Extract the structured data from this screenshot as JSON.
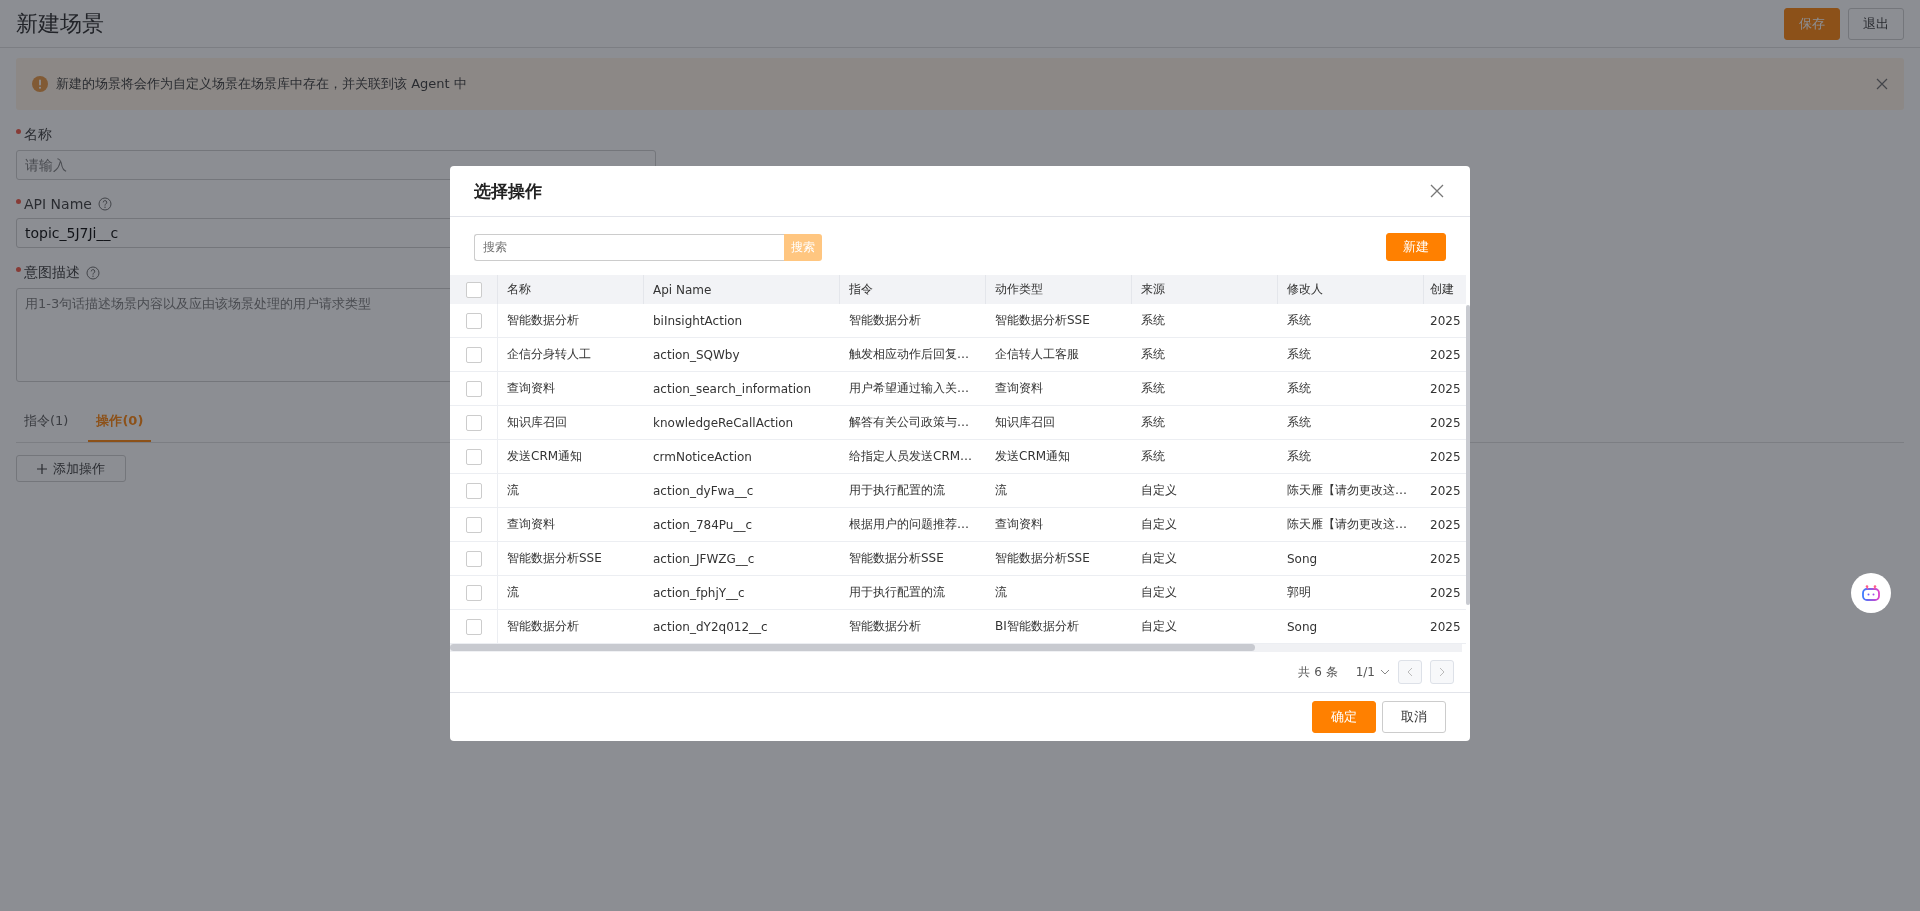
{
  "page": {
    "title": "新建场景",
    "buttons": [
      {
        "label": "保存",
        "kind": "primary"
      },
      {
        "label": "退出",
        "kind": "default"
      }
    ]
  },
  "alert": {
    "text": "新建的场景将会作为自定义场景在场景库中存在，并关联到该 Agent 中",
    "closable": true
  },
  "form": {
    "fields": [
      {
        "label": "名称",
        "required": true,
        "help": false,
        "kind": "input",
        "placeholder": "请输入"
      },
      {
        "label": "API Name",
        "required": true,
        "help": true,
        "kind": "input",
        "value": "topic_5J7Ji__c"
      },
      {
        "label": "意图描述",
        "required": true,
        "help": true,
        "kind": "textarea",
        "placeholder": "用1-3句话描述场景内容以及应由该场景处理的用户请求类型"
      }
    ]
  },
  "tabs": [
    {
      "label": "指令(1)",
      "selected": false
    },
    {
      "label": "操作(0)",
      "selected": true
    }
  ],
  "add_button": "添加操作",
  "dialog": {
    "title": "选择操作",
    "search": {
      "placeholder": "搜索",
      "button": "搜索"
    },
    "new_button": "新建",
    "table": {
      "all_checked": false,
      "columns": [
        "名称",
        "Api Name",
        "指令",
        "动作类型",
        "来源",
        "修改人",
        "创建"
      ],
      "rows": [
        {
          "checked": false,
          "cells": [
            "智能数据分析",
            "biInsightAction",
            "智能数据分析",
            "智能数据分析SSE",
            "系统",
            "系统",
            "2025"
          ]
        },
        {
          "checked": false,
          "cells": [
            "企信分身转人工",
            "action_SQWby",
            "触发相应动作后回复…",
            "企信转人工客服",
            "系统",
            "系统",
            "2025"
          ]
        },
        {
          "checked": false,
          "cells": [
            "查询资料",
            "action_search_information",
            "用户希望通过输入关…",
            "查询资料",
            "系统",
            "系统",
            "2025"
          ]
        },
        {
          "checked": false,
          "cells": [
            "知识库召回",
            "knowledgeReCallAction",
            "解答有关公司政策与…",
            "知识库召回",
            "系统",
            "系统",
            "2025"
          ]
        },
        {
          "checked": false,
          "cells": [
            "发送CRM通知",
            "crmNoticeAction",
            "给指定人员发送CRM…",
            "发送CRM通知",
            "系统",
            "系统",
            "2025"
          ]
        },
        {
          "checked": false,
          "cells": [
            "流",
            "action_dyFwa__c",
            "用于执行配置的流",
            "流",
            "自定义",
            "陈天雁【请勿更改这…",
            "2025"
          ]
        },
        {
          "checked": false,
          "cells": [
            "查询资料",
            "action_784Pu__c",
            "根据用户的问题推荐…",
            "查询资料",
            "自定义",
            "陈天雁【请勿更改这…",
            "2025"
          ]
        },
        {
          "checked": false,
          "cells": [
            "智能数据分析SSE",
            "action_JFWZG__c",
            "智能数据分析SSE",
            "智能数据分析SSE",
            "自定义",
            "Song",
            "2025"
          ]
        },
        {
          "checked": false,
          "cells": [
            "流",
            "action_fphjY__c",
            "用于执行配置的流",
            "流",
            "自定义",
            "郭明",
            "2025"
          ]
        },
        {
          "checked": false,
          "cells": [
            "智能数据分析",
            "action_dY2q012__c",
            "智能数据分析",
            "BI智能数据分析",
            "自定义",
            "Song",
            "2025"
          ]
        }
      ]
    },
    "pagination": {
      "total": "共 6 条",
      "page": "1/1"
    },
    "buttons": [
      {
        "label": "确定",
        "kind": "primary"
      },
      {
        "label": "取消",
        "kind": "default"
      }
    ]
  }
}
